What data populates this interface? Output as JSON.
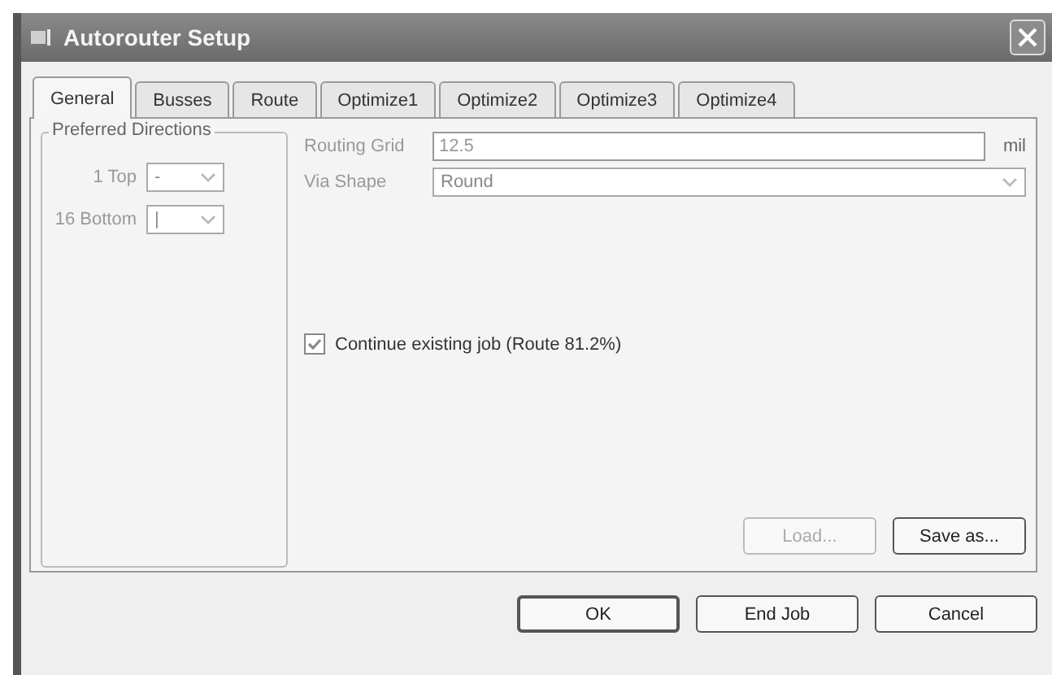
{
  "window": {
    "title": "Autorouter Setup"
  },
  "tabs": [
    {
      "label": "General",
      "selected": true
    },
    {
      "label": "Busses",
      "selected": false
    },
    {
      "label": "Route",
      "selected": false
    },
    {
      "label": "Optimize1",
      "selected": false
    },
    {
      "label": "Optimize2",
      "selected": false
    },
    {
      "label": "Optimize3",
      "selected": false
    },
    {
      "label": "Optimize4",
      "selected": false
    }
  ],
  "preferred_directions": {
    "title": "Preferred Directions",
    "layers": [
      {
        "label": "1 Top",
        "value": "-",
        "disabled": true
      },
      {
        "label": "16 Bottom",
        "value": "|",
        "disabled": true
      }
    ]
  },
  "routing_grid": {
    "label": "Routing Grid",
    "value": "12.5",
    "unit": "mil",
    "disabled": true
  },
  "via_shape": {
    "label": "Via Shape",
    "value": "Round",
    "disabled": true
  },
  "continue_job": {
    "label": "Continue existing job (Route 81.2%)",
    "checked": true
  },
  "file_buttons": [
    {
      "label": "Load...",
      "disabled": true
    },
    {
      "label": "Save as...",
      "disabled": false
    }
  ],
  "buttons": [
    {
      "label": "OK",
      "default": true
    },
    {
      "label": "End Job",
      "default": false
    },
    {
      "label": "Cancel",
      "default": false
    }
  ]
}
